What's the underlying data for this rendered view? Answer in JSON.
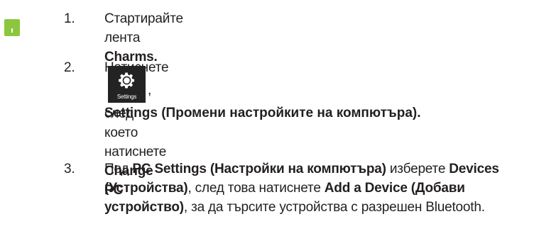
{
  "steps": [
    {
      "number": "1.",
      "text_before": "Стартирайте лента ",
      "bold_1": "Charms."
    },
    {
      "number": "2.",
      "text_before": "Натиснете ",
      "tile_label": "Settings",
      "text_after": ", след което натиснете ",
      "bold_1": "Change PC",
      "bold_2": "Settings (Промени настройките на компютъра)."
    },
    {
      "number": "3.",
      "text_before": "Под ",
      "bold_1": "PC Settings (Настройки на компютъра)",
      "text_mid_1": " изберете ",
      "bold_2": "Devices (Устройства)",
      "text_mid_2": ", след това натиснете ",
      "bold_3": "Add a Device (Добави устройство)",
      "text_after": ", за да търсите устройства с разрешен Bluetooth."
    }
  ],
  "colors": {
    "marker": "#8cc63f",
    "settings_tile": "#232323",
    "text": "#231f20"
  },
  "icons": {
    "settings": "gear-icon"
  }
}
